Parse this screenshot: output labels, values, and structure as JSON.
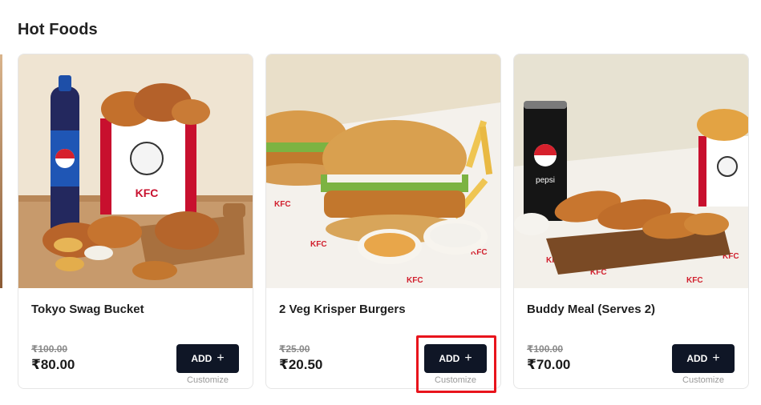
{
  "section": {
    "title": "Hot Foods"
  },
  "colors": {
    "button_bg": "#0f1626",
    "highlight": "#e8141c",
    "old_price": "#8a8a8a"
  },
  "products": [
    {
      "name": "Tokyo Swag Bucket",
      "old_price": "₹100.00",
      "price": "₹80.00",
      "add_label": "ADD",
      "add_icon": "plus-icon",
      "customize_label": "Customize",
      "image_icon": "kfc-bucket-with-pepsi"
    },
    {
      "name": "2 Veg Krisper Burgers",
      "old_price": "₹25.00",
      "price": "₹20.50",
      "add_label": "ADD",
      "add_icon": "plus-icon",
      "customize_label": "Customize",
      "image_icon": "burgers-with-dips"
    },
    {
      "name": "Buddy Meal (Serves 2)",
      "old_price": "₹100.00",
      "price": "₹70.00",
      "add_label": "ADD",
      "add_icon": "plus-icon",
      "customize_label": "Customize",
      "image_icon": "pepsi-can-with-strips"
    }
  ]
}
